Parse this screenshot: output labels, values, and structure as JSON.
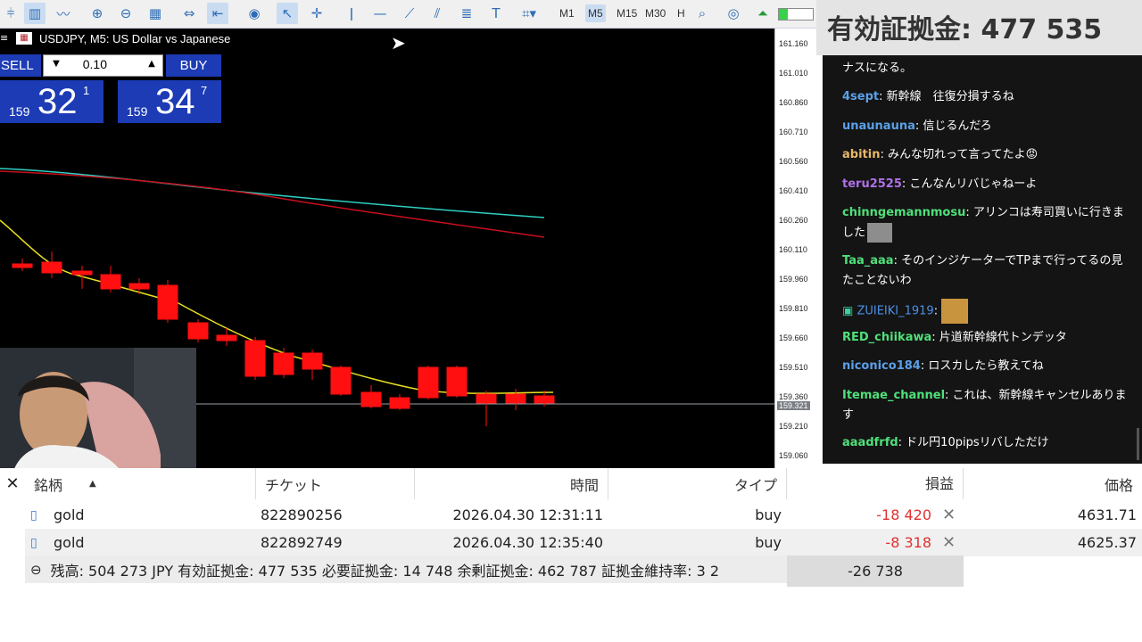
{
  "toolbar": {
    "timeframes": [
      "M1",
      "M5",
      "M15",
      "M30",
      "H"
    ],
    "active_timeframe": "M5"
  },
  "chart": {
    "title": "USDJPY, M5: US Dollar vs Japanese",
    "price_labels": [
      "161.160",
      "161.010",
      "160.860",
      "160.710",
      "160.560",
      "160.410",
      "160.260",
      "160.110",
      "159.960",
      "159.810",
      "159.660",
      "159.510",
      "159.360",
      "159.210",
      "159.060"
    ],
    "current_price_label": "159.321"
  },
  "trade_panel": {
    "sell_label": "SELL",
    "buy_label": "BUY",
    "lot": "0.10",
    "sell_quote": {
      "prefix": "159",
      "big": "32",
      "sup": "1"
    },
    "buy_quote": {
      "prefix": "159",
      "big": "34",
      "sup": "7"
    }
  },
  "stream": {
    "margin_header": "有効証拠金: 477 535",
    "chat": [
      {
        "user": "",
        "text": "ナスになる。",
        "color": "#ffffff"
      },
      {
        "user": "4sept",
        "text": "新幹線　往復分損するね",
        "color": "#5aa0e8"
      },
      {
        "user": "unaunauna",
        "text": "信じるんだろ",
        "color": "#5aa0e8"
      },
      {
        "user": "abitin",
        "text": "みんな切れって言ってたよ😡",
        "color": "#e8b86a"
      },
      {
        "user": "teru2525",
        "text": "こんなんリバじゃねーよ",
        "color": "#b070e8"
      },
      {
        "user": "chinngemannmosu",
        "text": "アリンコは寿司買いに行きました",
        "color": "#4fe07a"
      },
      {
        "user": "Taa_aaa",
        "text": "そのインジケーターでTPまで行ってるの見たことないわ",
        "color": "#4fe07a"
      },
      {
        "user": "ZUIEIKI_1919",
        "text": "",
        "color": "#4a90e8"
      },
      {
        "user": "RED_chiikawa",
        "text": "片道新幹線代トンデッタ",
        "color": "#4fe07a"
      },
      {
        "user": "niconico184",
        "text": "ロスカしたら教えてね",
        "color": "#5aa0e8"
      },
      {
        "user": "Itemae_channel",
        "text": "これは、新幹線キャンセルあります",
        "color": "#4fe07a"
      },
      {
        "user": "aaadfrfd",
        "text": "ドル円10pipsリバしただけ",
        "color": "#4fe07a"
      }
    ]
  },
  "trades": {
    "headers": [
      "銘柄",
      "チケット",
      "時間",
      "タイプ",
      "損益",
      "価格"
    ],
    "rows": [
      {
        "symbol": "gold",
        "ticket": "822890256",
        "time": "2026.04.30 12:31:11",
        "type": "buy",
        "profit": "-18 420",
        "price": "4631.71"
      },
      {
        "symbol": "gold",
        "ticket": "822892749",
        "time": "2026.04.30 12:35:40",
        "type": "buy",
        "profit": "-8 318",
        "price": "4625.37"
      }
    ],
    "summary": "残高: 504 273 JPY  有効証拠金: 477 535  必要証拠金: 14 748  余剰証拠金: 462 787  証拠金維持率: 3 2",
    "total": "-26 738"
  }
}
